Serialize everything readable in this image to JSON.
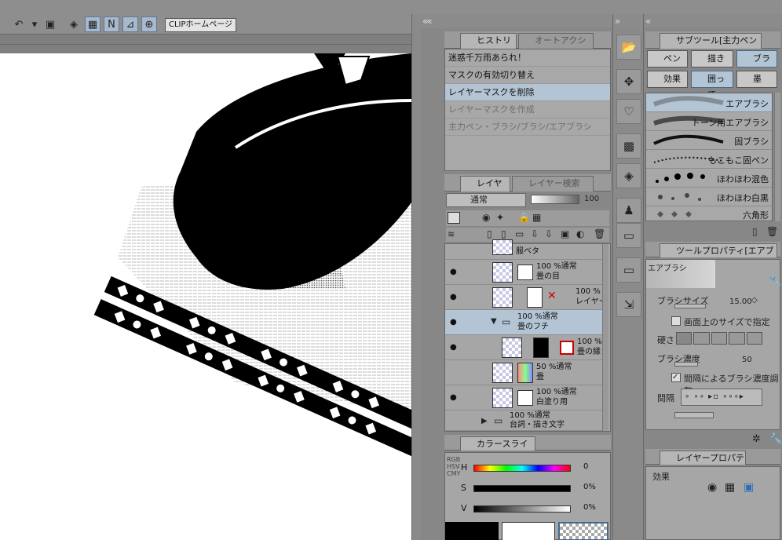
{
  "toolbar": {
    "clip_home_label": "CLIPホームページ"
  },
  "history": {
    "tabs": [
      "ヒストリー",
      "オートアクション"
    ],
    "items": [
      "迷惑千万雨あられ！",
      "マスクの有効切り替え",
      "レイヤーマスクを削除",
      "レイヤーマスクを作成",
      "主力ペン・ブラシ/ブラシ/エアブラシ"
    ],
    "selected_index": 2
  },
  "layers": {
    "tabs": [
      "レイヤー",
      "レイヤー検索"
    ],
    "blend_mode": "通常",
    "opacity": "100",
    "rows": [
      {
        "opacity_mode": "",
        "name": "服ベタ"
      },
      {
        "opacity_mode": "100 %通常",
        "name": "畳の目"
      },
      {
        "opacity_mode": "100 %",
        "name": "レイヤー"
      },
      {
        "opacity_mode": "100 %通常",
        "name": "畳のフチ"
      },
      {
        "opacity_mode": "100 %",
        "name": "畳の縁"
      },
      {
        "opacity_mode": "50 %通常",
        "name": "畳"
      },
      {
        "opacity_mode": "100 %通常",
        "name": "白塗り用"
      },
      {
        "opacity_mode": "100 %通常",
        "name": "台詞・描き文字"
      }
    ]
  },
  "color_slider": {
    "tab": "カラースライダー",
    "side_labels": [
      "RGB",
      "HSV",
      "CMY"
    ],
    "sliders": [
      {
        "label": "H",
        "value": "0"
      },
      {
        "label": "S",
        "value": "0%"
      },
      {
        "label": "V",
        "value": "0%"
      }
    ]
  },
  "subtool": {
    "tab": "サブツール[主力ペン",
    "buttons": [
      "ペン",
      "描き",
      "ブラシ",
      "効果",
      "囲って",
      "墨"
    ],
    "selected_button": "ブラシ",
    "brushes": [
      "エアブラシ",
      "トーン用エアブラシ",
      "固ブラシ",
      "もこもこ固ペン",
      "ほわほわ混色",
      "ほわほわ白黒",
      "六角形"
    ],
    "selected_brush": "エアブラシ"
  },
  "tool_property": {
    "tab": "ツールプロパティ[エアブラシ",
    "preview_label": "エアブラシ",
    "brush_size_label": "ブラシサイズ",
    "brush_size_value": "15.00",
    "screen_size_label": "画面上のサイズで指定",
    "hardness_label": "硬さ",
    "density_label": "ブラシ濃度",
    "density_value": "50",
    "density_by_interval_label": "間隔によるブラシ濃度調整",
    "interval_label": "間隔"
  },
  "layer_property": {
    "tab": "レイヤープロパティ",
    "effect_label": "効果"
  },
  "colors": {
    "panel_bg": "#a6a6a6",
    "selection": "#b3c4d4",
    "accent": "#466a8e"
  }
}
